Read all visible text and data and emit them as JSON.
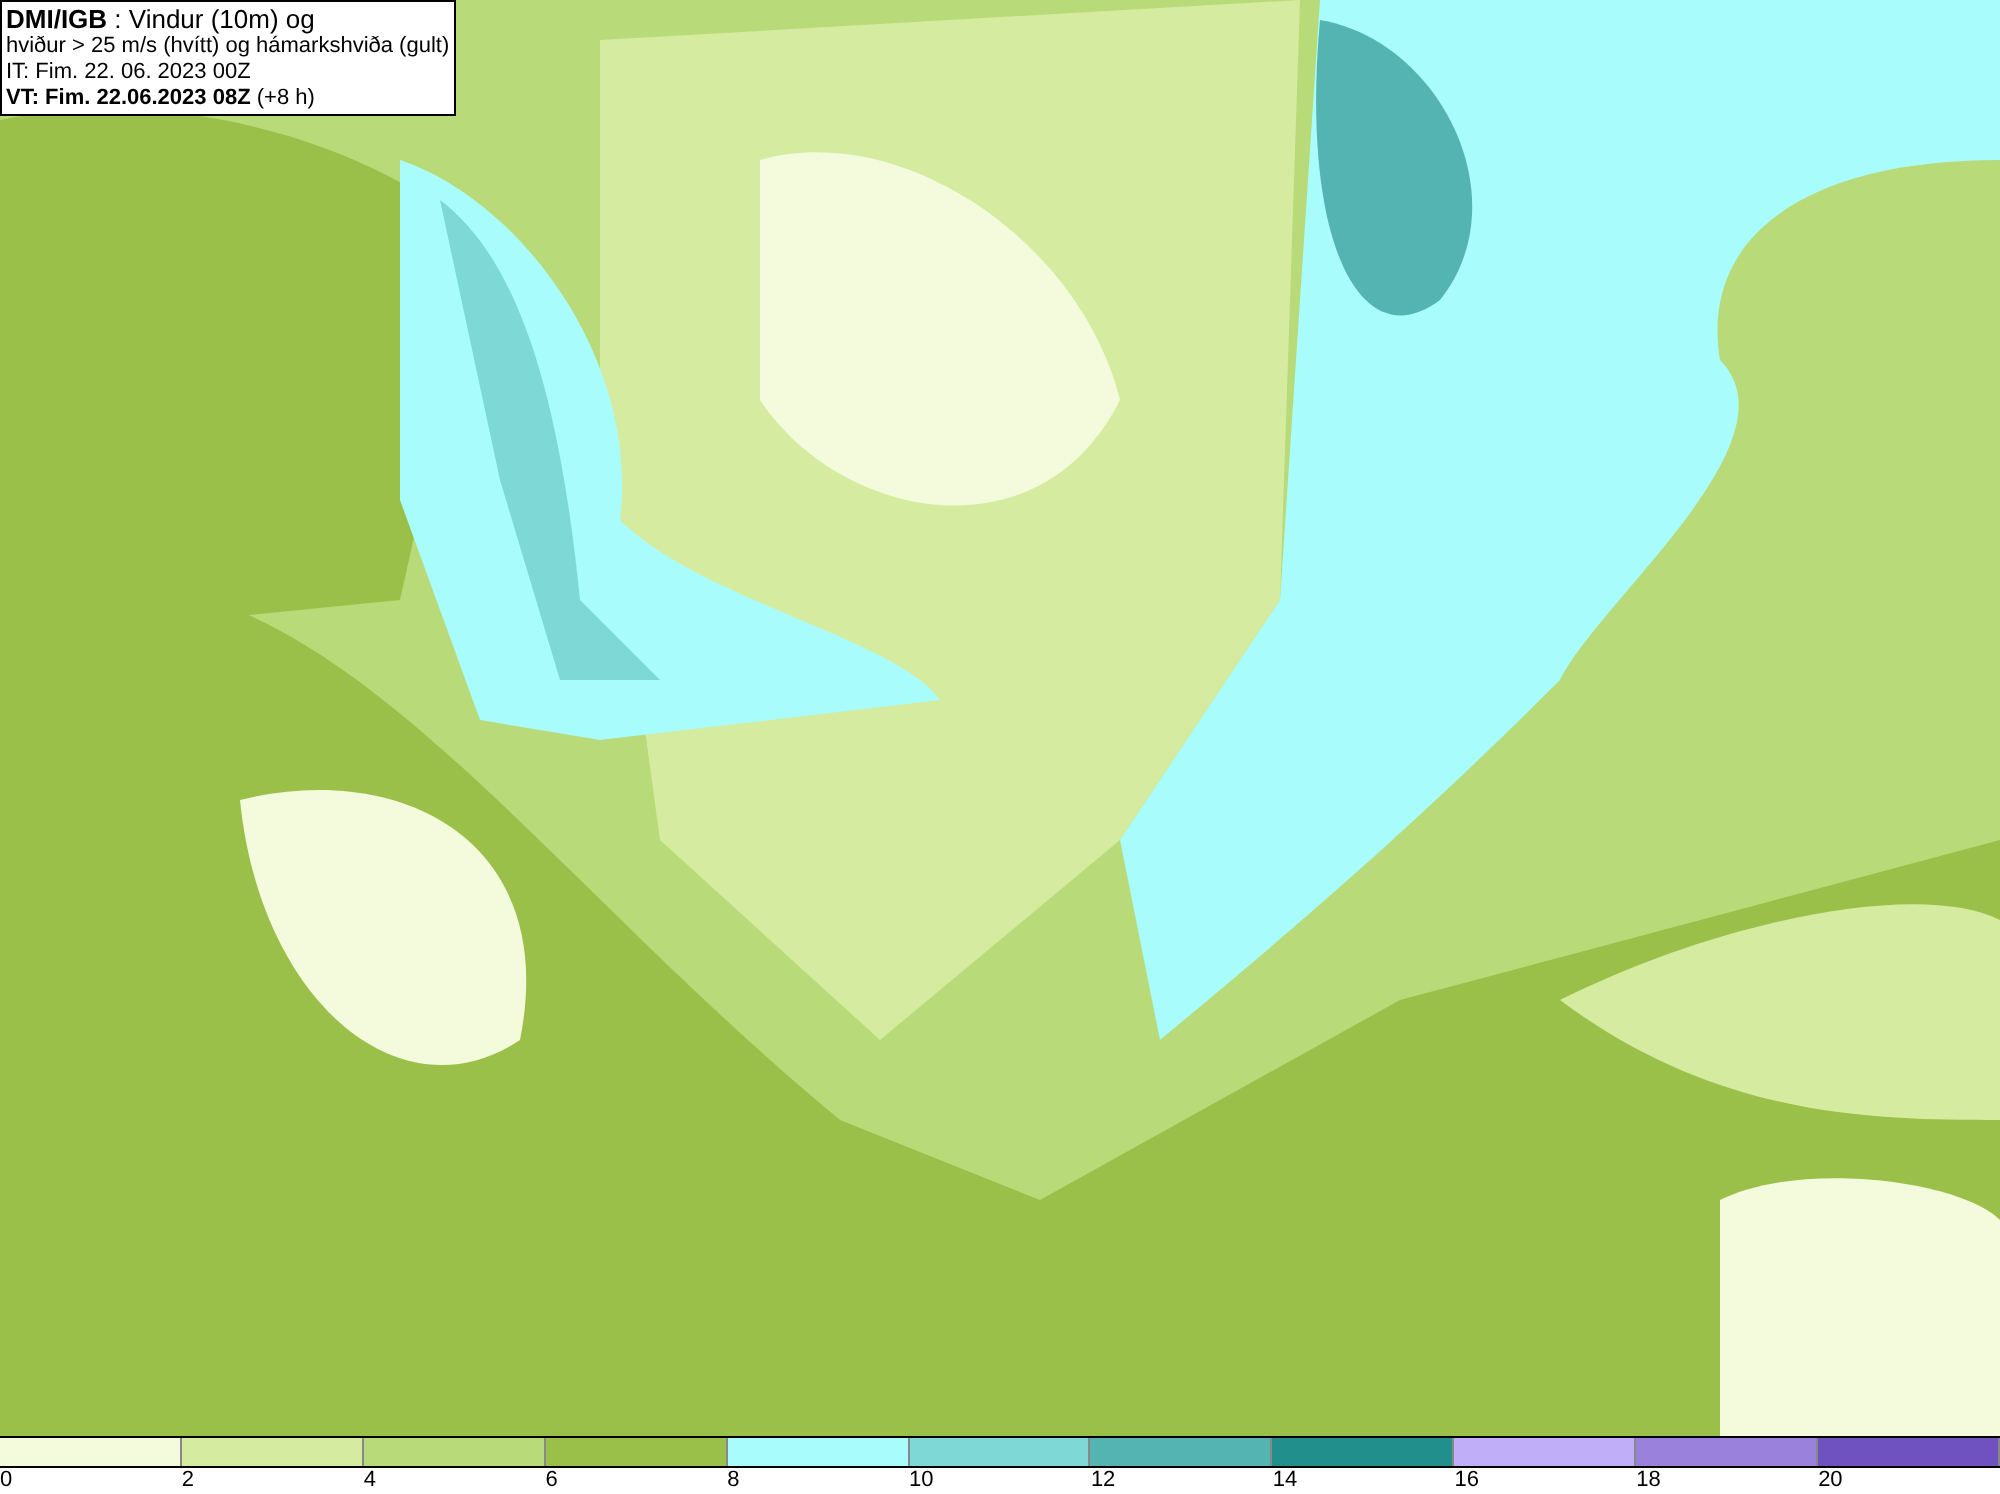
{
  "info_box": {
    "lines": [
      "**DMI/IGB** : Vindur (10m) og",
      "hviður > 25 m/s (hvítt) og hámarkshviða (gult)",
      "IT: Fim. 22. 06. 2023 00Z",
      "**VT: Fim. 22.06.2023 08Z** (+8 h)"
    ]
  },
  "legend": {
    "segments": [
      {
        "color": "#f4fbdc"
      },
      {
        "color": "#d5eca0"
      },
      {
        "color": "#b8da78"
      },
      {
        "color": "#9bc04a"
      },
      {
        "color": "#a9fcfc"
      },
      {
        "color": "#7dd8d6"
      },
      {
        "color": "#54b4b2"
      },
      {
        "color": "#218f8c"
      },
      {
        "color": "#c0aef8"
      },
      {
        "color": "#9a82dc"
      },
      {
        "color": "#6f52c0"
      }
    ],
    "labels": [
      "0",
      "2",
      "4",
      "6",
      "8",
      "10",
      "12",
      "14",
      "16",
      "18",
      "20"
    ]
  }
}
